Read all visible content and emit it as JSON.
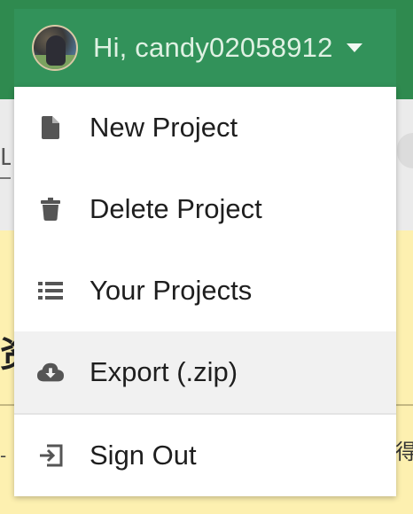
{
  "header": {
    "greeting": "Hi, candy02058912",
    "avatar_icon": "user-avatar",
    "caret_icon": "caret-down-icon",
    "accent_color": "#32925a"
  },
  "menu": {
    "items": [
      {
        "label": "New Project",
        "icon": "file-icon"
      },
      {
        "label": "Delete Project",
        "icon": "trash-icon"
      },
      {
        "label": "Your Projects",
        "icon": "list-icon"
      },
      {
        "label": "Export (.zip)",
        "icon": "cloud-download-icon",
        "highlighted": true
      },
      {
        "label": "Sign Out",
        "icon": "sign-out-icon"
      }
    ]
  },
  "background": {
    "left_fragment": "L",
    "heading_fragment": "资",
    "mark_left": "-",
    "mark_right": "得"
  }
}
